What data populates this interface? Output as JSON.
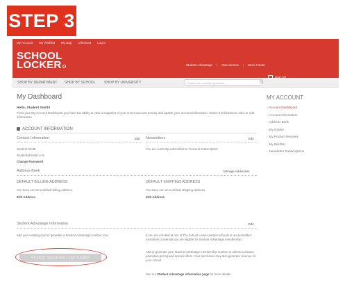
{
  "step_label": "STEP 3",
  "top_links": [
    "My Account",
    "My Wishlist",
    "My Bag",
    "Checkout",
    "Log In"
  ],
  "logo": {
    "line1": "SCHOOL",
    "line2": "LOCKER"
  },
  "header_links": [
    "Student Advantage",
    "|",
    "Mac Service",
    "|",
    "Store Finder"
  ],
  "nav": {
    "items": [
      "SHOP BY DEPARTMENT",
      "SHOP BY SCHOOL",
      "SHOP BY UNIVERSITY"
    ],
    "search_placeholder": "Search our courses, products...",
    "bag_label": "BAG (0)"
  },
  "dashboard": {
    "title": "My Dashboard",
    "hello": "Hello, Student Smith!",
    "intro": "From your My Account Dashboard you have the ability to view a snapshot of your recent account activity and update your account information. Select a link below to view or edit information.",
    "account_info_heading": "ACCOUNT INFORMATION",
    "contact": {
      "title": "Contact Information",
      "edit": "Edit",
      "name": "Student Smith",
      "email": "Student@Smith.com",
      "change_password": "Change Password"
    },
    "newsletters": {
      "title": "Newsletters",
      "edit": "Edit",
      "text": "You are currently subscribed to 'General Subscription'."
    },
    "address_book": {
      "title": "Address Book",
      "manage": "Manage Addresses"
    },
    "billing": {
      "title": "DEFAULT BILLING ADDRESS",
      "text": "You have not set a default billing address.",
      "edit": "Edit Address"
    },
    "shipping": {
      "title": "DEFAULT SHIPPING ADDRESS",
      "text": "You have not set a default shipping address.",
      "edit": "Edit Address"
    },
    "student_advantage": {
      "title": "Student Advantage Information",
      "edit": "Edit",
      "left_text": "Add your existing card or generate a Student Advantage number now.",
      "button": "STUDENT ADVANTAGE CARD NUMBER",
      "right_p1": "If you are enrolled at one of The School Locker partner schools or an accredited Australian University you are eligible for Student Advantage membership.",
      "right_p2": "Add or generate your Student Advantage membership number to unlock exclusive education pricing and special offers. Your purchases may also generate revenue for your school.",
      "right_p3_pre": "See our",
      "right_p3_link": "Student Advantage information page",
      "right_p3_post": "for more details."
    }
  },
  "my_account": {
    "title": "MY ACCOUNT",
    "items": [
      "Account Dashboard",
      "Account Information",
      "Address Book",
      "My Orders",
      "My Product Reviews",
      "My Wishlist",
      "Newsletter Subscriptions"
    ]
  },
  "colors": {
    "brand_red": "#d63a2f",
    "banner_red": "#e0301e",
    "highlight_oval": "#d84a3c"
  }
}
